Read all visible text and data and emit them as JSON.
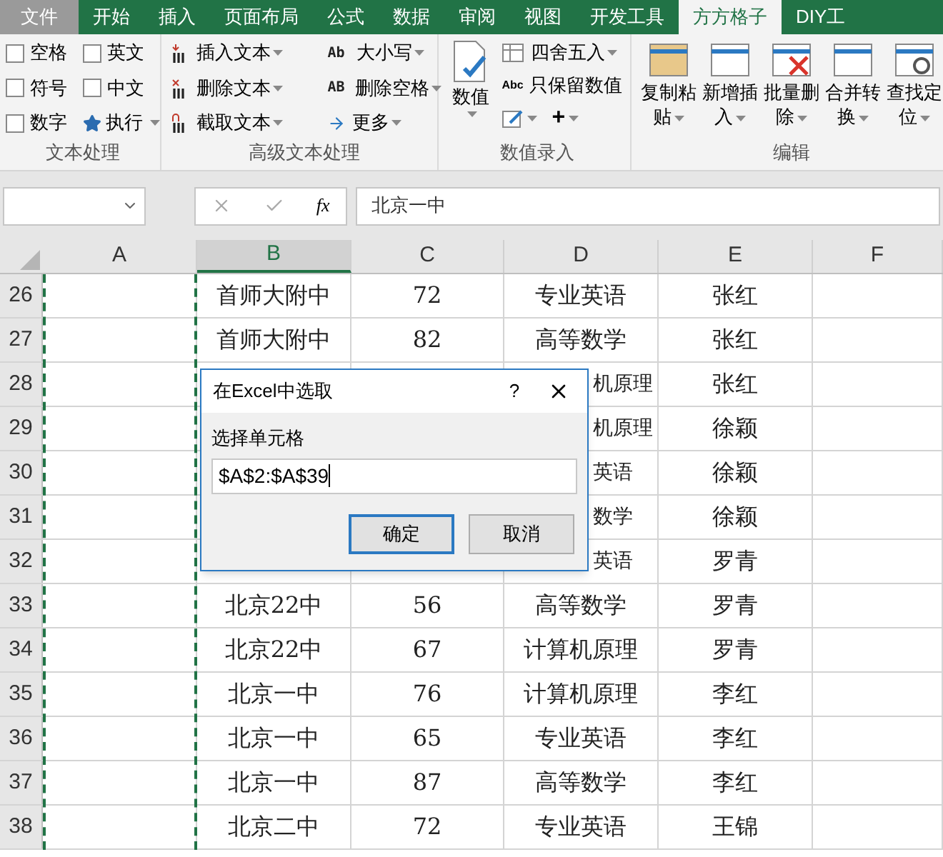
{
  "tabs": [
    {
      "label": "文件",
      "kind": "file",
      "selected": false
    },
    {
      "label": "开始",
      "kind": "tab",
      "selected": false
    },
    {
      "label": "插入",
      "kind": "tab",
      "selected": false
    },
    {
      "label": "页面布局",
      "kind": "tab",
      "selected": false
    },
    {
      "label": "公式",
      "kind": "tab",
      "selected": false
    },
    {
      "label": "数据",
      "kind": "tab",
      "selected": false
    },
    {
      "label": "审阅",
      "kind": "tab",
      "selected": false
    },
    {
      "label": "视图",
      "kind": "tab",
      "selected": false
    },
    {
      "label": "开发工具",
      "kind": "tab",
      "selected": false
    },
    {
      "label": "方方格子",
      "kind": "tab",
      "selected": true
    },
    {
      "label": "DIY工",
      "kind": "tab",
      "selected": false
    }
  ],
  "text_group": {
    "label": "文本处理",
    "checkboxes": [
      {
        "label": "空格",
        "checked": false
      },
      {
        "label": "英文",
        "checked": false
      },
      {
        "label": "符号",
        "checked": false
      },
      {
        "label": "中文",
        "checked": false
      },
      {
        "label": "数字",
        "checked": false
      }
    ],
    "run_button": "执行"
  },
  "advanced_group": {
    "label": "高级文本处理",
    "items": [
      {
        "label": "插入文本"
      },
      {
        "label": "大小写",
        "icon_text": "Ab"
      },
      {
        "label": "删除文本"
      },
      {
        "label": "删除空格",
        "icon_text": "AB"
      },
      {
        "label": "截取文本"
      },
      {
        "label": "更多"
      }
    ]
  },
  "number_group": {
    "label": "数值录入",
    "value_button": "数值",
    "round_button": "四舍五入",
    "keep_button": "只保留数值",
    "keep_icon_text": "Abc",
    "plus": "+"
  },
  "edit_group": {
    "label": "编辑",
    "buttons": [
      {
        "label": "复制粘贴"
      },
      {
        "label": "新增插入"
      },
      {
        "label": "批量删除"
      },
      {
        "label": "合并转换"
      },
      {
        "label": "查找定位"
      }
    ]
  },
  "formula_bar": {
    "fx": "fx",
    "value": "北京一中"
  },
  "columns": [
    {
      "label": "A",
      "selected": false
    },
    {
      "label": "B",
      "selected": true
    },
    {
      "label": "C",
      "selected": false
    },
    {
      "label": "D",
      "selected": false
    },
    {
      "label": "E",
      "selected": false
    },
    {
      "label": "F",
      "selected": false
    }
  ],
  "rows": [
    {
      "number": "26",
      "b": "首师大附中",
      "c": "72",
      "d": "专业英语",
      "e": "张红"
    },
    {
      "number": "27",
      "b": "首师大附中",
      "c": "82",
      "d": "高等数学",
      "e": "张红"
    },
    {
      "number": "28",
      "d": "机原理",
      "d_partial": true,
      "e": "张红"
    },
    {
      "number": "29",
      "d": "机原理",
      "d_partial": true,
      "e": "徐颖"
    },
    {
      "number": "30",
      "d": "英语",
      "d_partial": true,
      "e": "徐颖"
    },
    {
      "number": "31",
      "d": "数学",
      "d_partial": true,
      "e": "徐颖"
    },
    {
      "number": "32",
      "d": "英语",
      "d_partial": true,
      "e": "罗青"
    },
    {
      "number": "33",
      "b": "北京22中",
      "c": "56",
      "d": "高等数学",
      "e": "罗青"
    },
    {
      "number": "34",
      "b": "北京22中",
      "c": "67",
      "d": "计算机原理",
      "e": "罗青"
    },
    {
      "number": "35",
      "b": "北京一中",
      "c": "76",
      "d": "计算机原理",
      "e": "李红"
    },
    {
      "number": "36",
      "b": "北京一中",
      "c": "65",
      "d": "专业英语",
      "e": "李红"
    },
    {
      "number": "37",
      "b": "北京一中",
      "c": "87",
      "d": "高等数学",
      "e": "李红"
    },
    {
      "number": "38",
      "b": "北京二中",
      "c": "72",
      "d": "专业英语",
      "e": "王锦"
    }
  ],
  "dialog": {
    "title": "在Excel中选取",
    "help": "?",
    "label": "选择单元格",
    "value": "$A$2:$A$39",
    "buttons": [
      {
        "label": "确定",
        "selected": true
      },
      {
        "label": "取消",
        "selected": false
      }
    ]
  }
}
